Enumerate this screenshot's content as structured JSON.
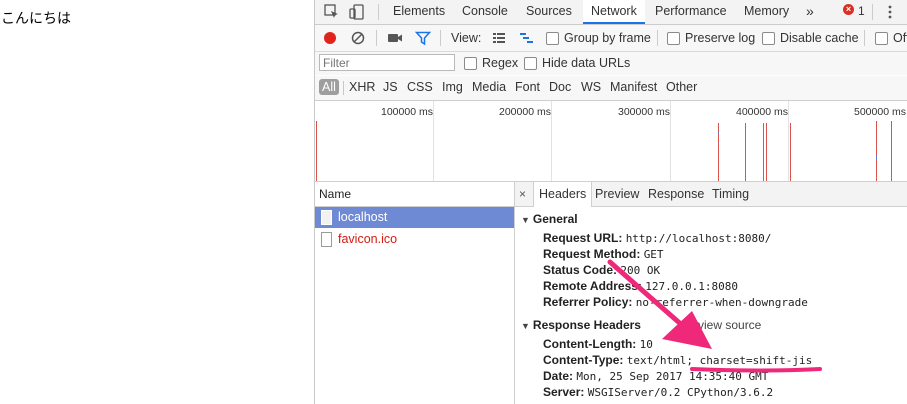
{
  "page": {
    "text": "こんにちは"
  },
  "tabs": [
    "Elements",
    "Console",
    "Sources",
    "Network",
    "Performance",
    "Memory"
  ],
  "tabs_more": "»",
  "error_badge": "1",
  "toolbar": {
    "view_label": "View:",
    "group_by_frame": "Group by frame",
    "preserve_log": "Preserve log",
    "disable_cache": "Disable cache",
    "offline_partial": "Off"
  },
  "filter": {
    "placeholder": "Filter",
    "regex": "Regex",
    "hide_data_urls": "Hide data URLs"
  },
  "types": [
    "All",
    "XHR",
    "JS",
    "CSS",
    "Img",
    "Media",
    "Font",
    "Doc",
    "WS",
    "Manifest",
    "Other"
  ],
  "overview": {
    "ticks": [
      "100000 ms",
      "200000 ms",
      "300000 ms",
      "400000 ms",
      "500000 ms"
    ]
  },
  "requests": {
    "header": "Name",
    "items": [
      {
        "name": "localhost"
      },
      {
        "name": "favicon.ico"
      }
    ]
  },
  "detail": {
    "close": "×",
    "tabs": [
      "Headers",
      "Preview",
      "Response",
      "Timing"
    ],
    "general": {
      "title": "General",
      "rows": [
        {
          "key": "Request URL:",
          "value": "http://localhost:8080/"
        },
        {
          "key": "Request Method:",
          "value": "GET"
        },
        {
          "key": "Status Code:",
          "value": "200 OK"
        },
        {
          "key": "Remote Address:",
          "value": "127.0.0.1:8080"
        },
        {
          "key": "Referrer Policy:",
          "value": "no-referrer-when-downgrade"
        }
      ]
    },
    "response_headers": {
      "title": "Response Headers",
      "view_source": "view source",
      "rows": [
        {
          "key": "Content-Length:",
          "value": "10"
        },
        {
          "key": "Content-Type:",
          "value": "text/html; charset=shift-jis"
        },
        {
          "key": "Date:",
          "value": "Mon, 25 Sep 2017 14:35:40 GMT"
        },
        {
          "key": "Server:",
          "value": "WSGIServer/0.2 CPython/3.6.2"
        }
      ]
    }
  },
  "colors": {
    "accent": "#1a73e8",
    "selected_row": "#6f8ad4",
    "error_text": "#d21c12",
    "annotation": "#f0287a"
  }
}
